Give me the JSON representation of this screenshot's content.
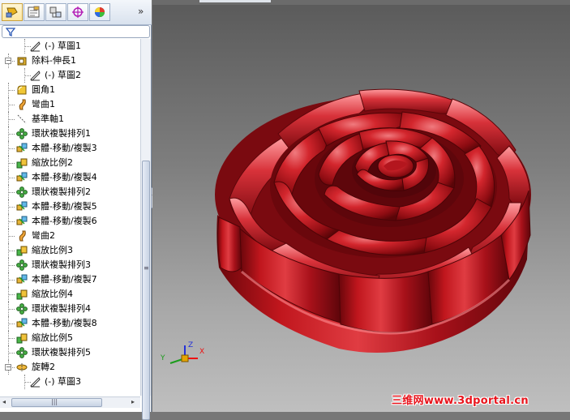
{
  "feature_tree": {
    "items": [
      {
        "label": "(-) 草圖1",
        "icon": "sketch-icon"
      },
      {
        "label": "除料-伸長1",
        "icon": "extruded-cut-icon"
      },
      {
        "label": "(-) 草圖2",
        "icon": "sketch-icon"
      },
      {
        "label": "圓角1",
        "icon": "fillet-icon"
      },
      {
        "label": "彎曲1",
        "icon": "flex-icon"
      },
      {
        "label": "基準軸1",
        "icon": "axis-icon"
      },
      {
        "label": "環狀複製排列1",
        "icon": "circular-pattern-icon"
      },
      {
        "label": "本體-移動/複製3",
        "icon": "move-copy-body-icon"
      },
      {
        "label": "縮放比例2",
        "icon": "scale-icon"
      },
      {
        "label": "本體-移動/複製4",
        "icon": "move-copy-body-icon"
      },
      {
        "label": "環狀複製排列2",
        "icon": "circular-pattern-icon"
      },
      {
        "label": "本體-移動/複製5",
        "icon": "move-copy-body-icon"
      },
      {
        "label": "本體-移動/複製6",
        "icon": "move-copy-body-icon"
      },
      {
        "label": "彎曲2",
        "icon": "flex-icon"
      },
      {
        "label": "縮放比例3",
        "icon": "scale-icon"
      },
      {
        "label": "環狀複製排列3",
        "icon": "circular-pattern-icon"
      },
      {
        "label": "本體-移動/複製7",
        "icon": "move-copy-body-icon"
      },
      {
        "label": "縮放比例4",
        "icon": "scale-icon"
      },
      {
        "label": "環狀複製排列4",
        "icon": "circular-pattern-icon"
      },
      {
        "label": "本體-移動/複製8",
        "icon": "move-copy-body-icon"
      },
      {
        "label": "縮放比例5",
        "icon": "scale-icon"
      },
      {
        "label": "環狀複製排列5",
        "icon": "circular-pattern-icon"
      },
      {
        "label": "旋轉2",
        "icon": "revolve-icon"
      },
      {
        "label": "(-) 草圖3",
        "icon": "sketch-icon"
      }
    ]
  },
  "tabs": [
    "feature-manager-tab",
    "property-manager-tab",
    "configuration-manager-tab",
    "dimxpert-tab",
    "display-manager-tab"
  ],
  "more_tabs_glyph": "»",
  "scrollbar": {
    "grip": "≡",
    "hgrip": "|||",
    "left": "◂",
    "right": "▸"
  },
  "splitter_glyph": "‹‹",
  "watermark": "三维网www.3dportal.cn",
  "triad": {
    "x": "X",
    "y": "Y",
    "z": "Z"
  },
  "colors": {
    "rose": "#b01218",
    "watermark": "#e8141c",
    "panel_border": "#7a8ba3"
  }
}
